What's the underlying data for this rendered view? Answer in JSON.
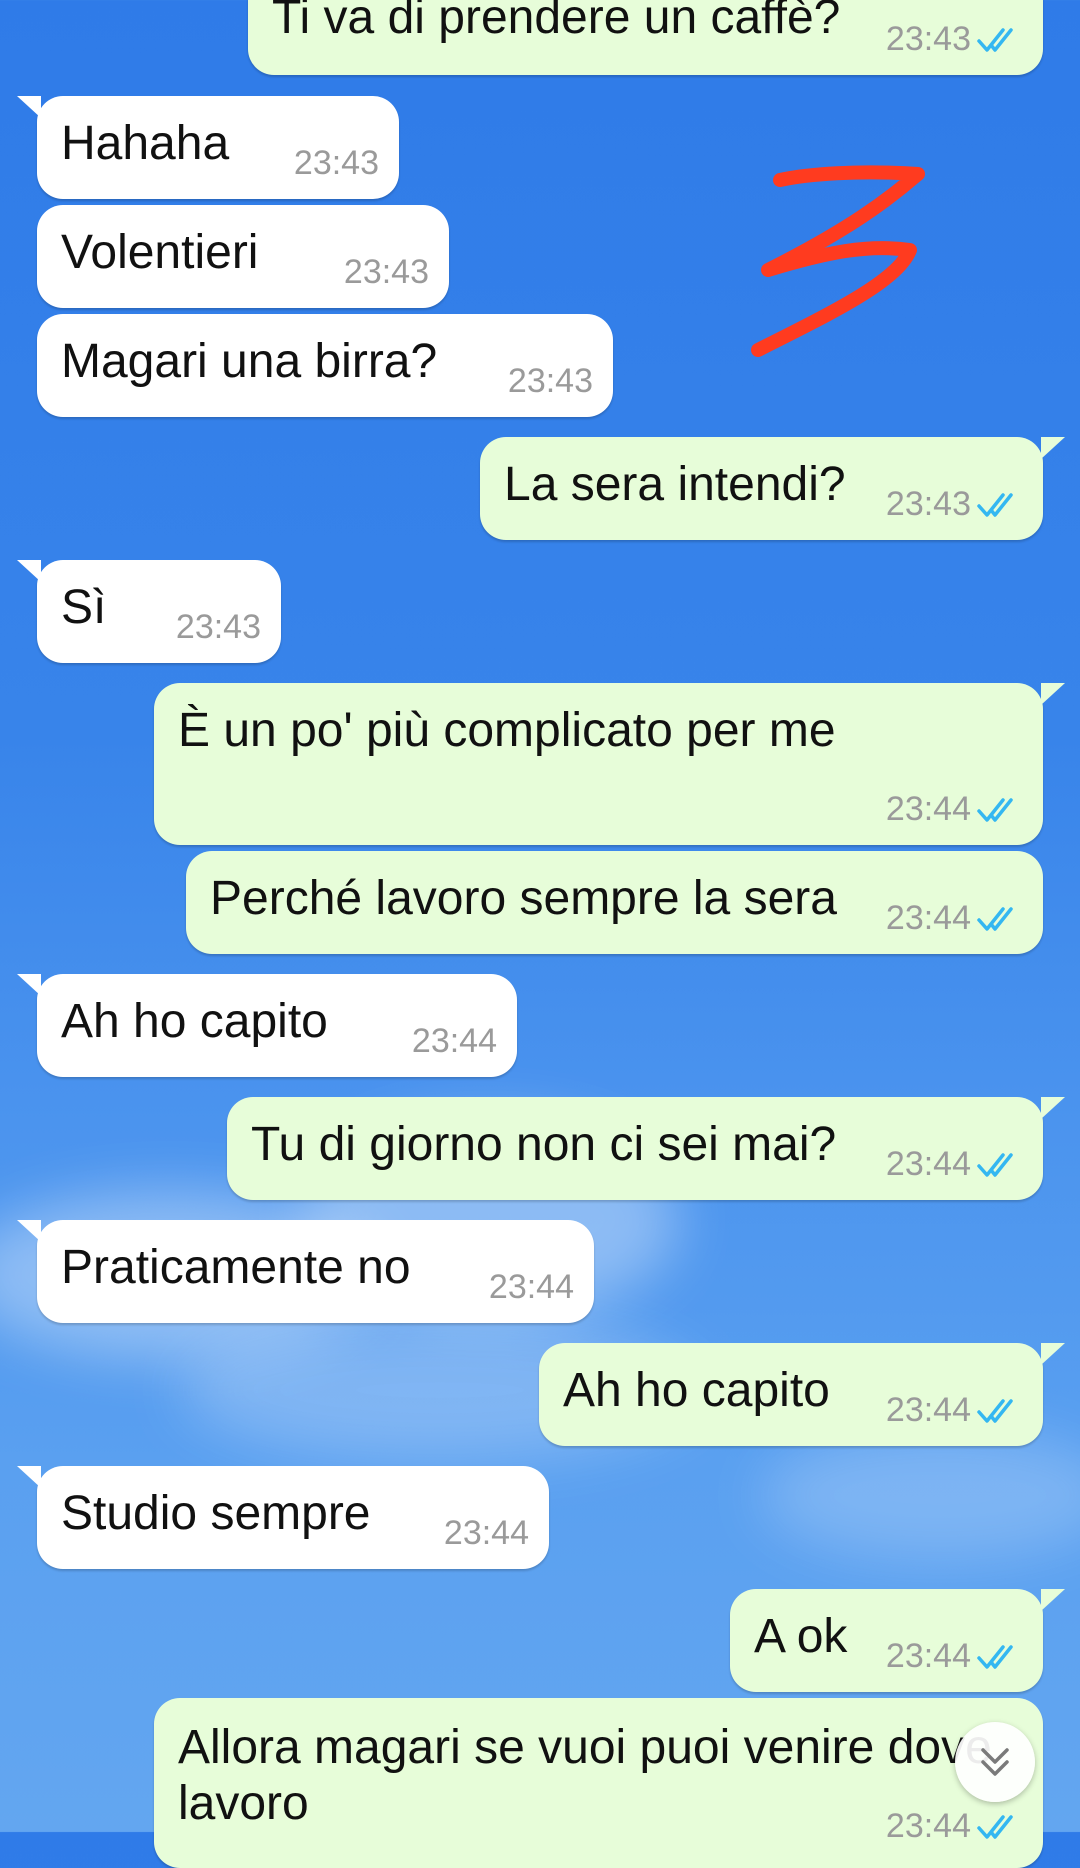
{
  "messages": [
    {
      "text": "Ti va di prendere un caffè?",
      "time": "23:43",
      "sent": true
    },
    {
      "text": "Hahaha",
      "time": "23:43",
      "sent": false
    },
    {
      "text": "Volentieri",
      "time": "23:43",
      "sent": false
    },
    {
      "text": "Magari una birra?",
      "time": "23:43",
      "sent": false
    },
    {
      "text": "La sera intendi?",
      "time": "23:43",
      "sent": true
    },
    {
      "text": "Sì",
      "time": "23:43",
      "sent": false
    },
    {
      "text": "È un po' più complicato per me",
      "time": "23:44",
      "sent": true
    },
    {
      "text": "Perché lavoro sempre la sera",
      "time": "23:44",
      "sent": true
    },
    {
      "text": "Ah ho capito",
      "time": "23:44",
      "sent": false
    },
    {
      "text": "Tu di giorno non ci sei mai?",
      "time": "23:44",
      "sent": true
    },
    {
      "text": "Praticamente no",
      "time": "23:44",
      "sent": false
    },
    {
      "text": "Ah ho capito",
      "time": "23:44",
      "sent": true
    },
    {
      "text": "Studio sempre",
      "time": "23:44",
      "sent": false
    },
    {
      "text": "A ok",
      "time": "23:44",
      "sent": true
    },
    {
      "text": "Allora magari se vuoi puoi venire dove",
      "text2": "lavoro",
      "time": "23:44",
      "sent": true
    }
  ],
  "colors": {
    "incoming_bubble": "#ffffff",
    "outgoing_bubble": "#e7fdd9",
    "read_ticks": "#34b7f1",
    "scribble": "#ff3b1f"
  },
  "icons": {
    "read_receipt": "double-check-icon",
    "scroll_down": "double-chevron-down-icon"
  }
}
